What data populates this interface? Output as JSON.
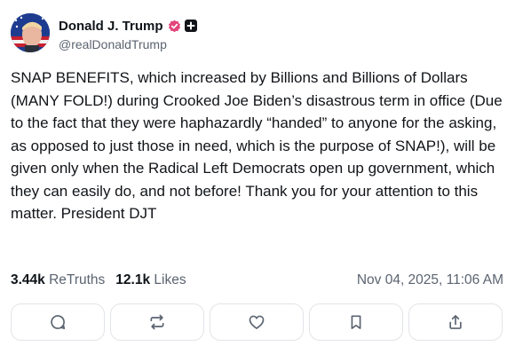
{
  "post": {
    "author_name": "Donald J. Trump",
    "author_handle": "@realDonaldTrump",
    "verified_icon": "verified-badge-icon",
    "extra_icon": "plus-badge-icon",
    "text": "SNAP BENEFITS, which increased by Billions and Billions of Dollars (MANY FOLD!) during Crooked Joe Biden’s disastrous term in office (Due to the fact that they were haphazardly “handed” to anyone for the asking, as opposed to just those in need, which is the purpose of SNAP!), will be given only when the Radical Left Democrats open up government, which they can easily do, and not before! Thank you for your attention to this matter. President DJT",
    "retruths_count": "3.44k",
    "retruths_label": "ReTruths",
    "likes_count": "12.1k",
    "likes_label": "Likes",
    "timestamp": "Nov 04, 2025, 11:06 AM"
  },
  "actions": [
    "reply-icon",
    "retruth-icon",
    "like-icon",
    "bookmark-icon",
    "share-icon"
  ],
  "colors": {
    "verified": "#e2467a",
    "text": "#111418",
    "muted": "#5b6470",
    "border": "#e1e4e8"
  }
}
